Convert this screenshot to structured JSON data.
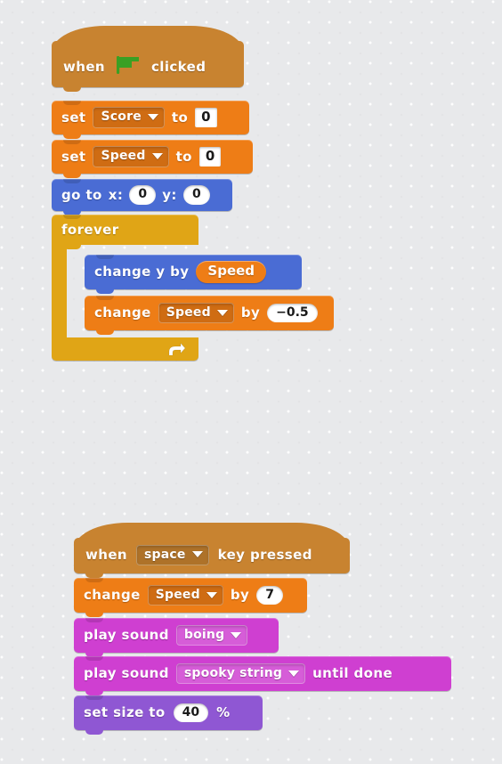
{
  "background": {
    "color": "#e8e9eb",
    "pattern": "dotted-grid"
  },
  "palette": {
    "events": "#c88330",
    "variables": "#ee7d16",
    "motion": "#4a6cd4",
    "control": "#e0a516",
    "sound": "#cf3fd1",
    "looks": "#8f57d3",
    "flag_green": "#3aa024"
  },
  "scripts": [
    {
      "name": "green-flag-script",
      "blocks": [
        {
          "id": "when-flag-clicked",
          "category": "events",
          "type": "hat",
          "words": {
            "before": "when",
            "after": "clicked"
          },
          "icon": "green-flag-icon"
        },
        {
          "id": "set-score-to-0",
          "category": "variables",
          "type": "stack",
          "words": {
            "verb": "set",
            "mid": "to"
          },
          "dropdown": "Score",
          "value": "0"
        },
        {
          "id": "set-speed-to-0",
          "category": "variables",
          "type": "stack",
          "words": {
            "verb": "set",
            "mid": "to"
          },
          "dropdown": "Speed",
          "value": "0"
        },
        {
          "id": "go-to-xy",
          "category": "motion",
          "type": "stack",
          "words": {
            "a": "go to",
            "x": "x:",
            "y": "y:"
          },
          "x_value": "0",
          "y_value": "0"
        },
        {
          "id": "forever-loop",
          "category": "control",
          "type": "c-block",
          "label": "forever",
          "icon": "loop-arrow-icon",
          "children": [
            {
              "id": "change-y-by-speed",
              "category": "motion",
              "type": "stack",
              "words": {
                "a": "change y by"
              },
              "reporter": "Speed"
            },
            {
              "id": "change-speed-by-neg",
              "category": "variables",
              "type": "stack",
              "words": {
                "verb": "change",
                "mid": "by"
              },
              "dropdown": "Speed",
              "value": "−0.5"
            }
          ]
        }
      ]
    },
    {
      "name": "space-key-script",
      "blocks": [
        {
          "id": "when-key-pressed",
          "category": "events",
          "type": "hat",
          "words": {
            "before": "when",
            "after": "key pressed"
          },
          "dropdown": "space"
        },
        {
          "id": "change-speed-by-7",
          "category": "variables",
          "type": "stack",
          "words": {
            "verb": "change",
            "mid": "by"
          },
          "dropdown": "Speed",
          "value": "7"
        },
        {
          "id": "play-sound-boing",
          "category": "sound",
          "type": "stack",
          "words": {
            "a": "play sound"
          },
          "dropdown": "boing"
        },
        {
          "id": "play-sound-until-done",
          "category": "sound",
          "type": "stack",
          "words": {
            "a": "play sound",
            "b": "until done"
          },
          "dropdown": "spooky string"
        },
        {
          "id": "set-size-to-40",
          "category": "looks",
          "type": "stack",
          "words": {
            "a": "set size to",
            "b": "%"
          },
          "value": "40"
        }
      ]
    }
  ]
}
